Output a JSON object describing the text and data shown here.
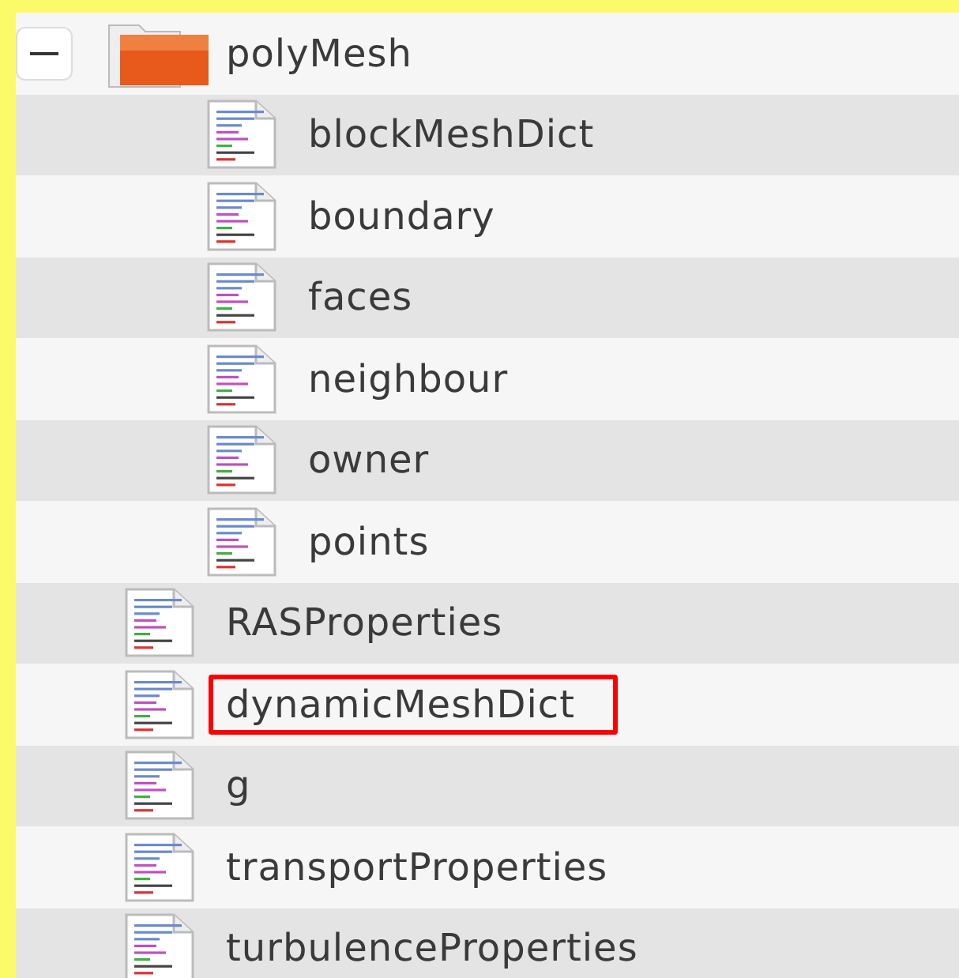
{
  "tree": [
    {
      "kind": "folder",
      "name": "polyMesh",
      "expanded": true,
      "highlighted": false,
      "children": [
        {
          "kind": "file",
          "name": "blockMeshDict",
          "highlighted": false
        },
        {
          "kind": "file",
          "name": "boundary",
          "highlighted": false
        },
        {
          "kind": "file",
          "name": "faces",
          "highlighted": false
        },
        {
          "kind": "file",
          "name": "neighbour",
          "highlighted": false
        },
        {
          "kind": "file",
          "name": "owner",
          "highlighted": false
        },
        {
          "kind": "file",
          "name": "points",
          "highlighted": false
        }
      ]
    },
    {
      "kind": "file",
      "name": "RASProperties",
      "highlighted": false
    },
    {
      "kind": "file",
      "name": "dynamicMeshDict",
      "highlighted": true
    },
    {
      "kind": "file",
      "name": "g",
      "highlighted": false
    },
    {
      "kind": "file",
      "name": "transportProperties",
      "highlighted": false
    },
    {
      "kind": "file",
      "name": "turbulenceProperties",
      "highlighted": false
    }
  ]
}
